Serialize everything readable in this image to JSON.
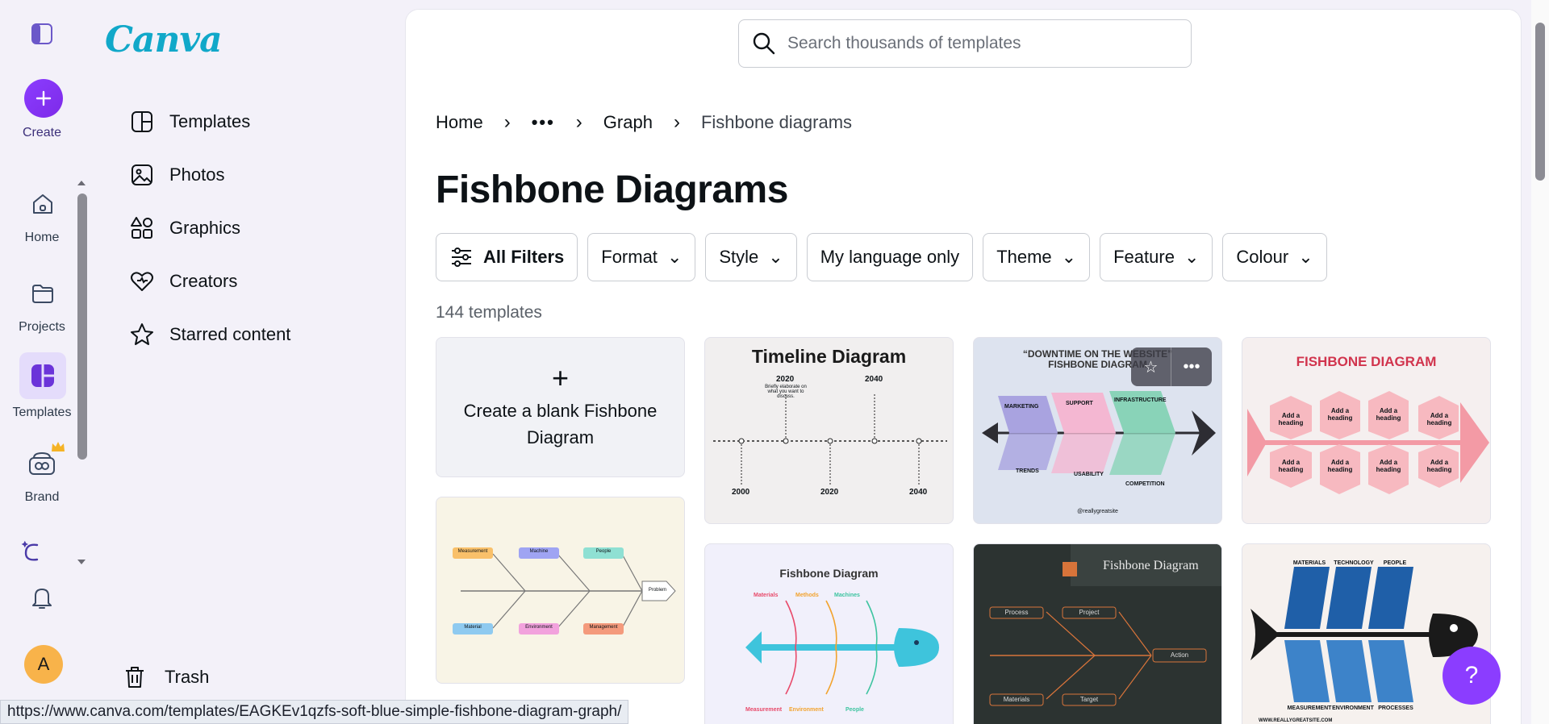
{
  "app": {
    "logo": "Canva"
  },
  "rail": {
    "create": "Create",
    "items": [
      {
        "label": "Home"
      },
      {
        "label": "Projects"
      },
      {
        "label": "Templates"
      },
      {
        "label": "Brand"
      }
    ],
    "avatar_initial": "A"
  },
  "side_nav": {
    "items": [
      {
        "label": "Templates"
      },
      {
        "label": "Photos"
      },
      {
        "label": "Graphics"
      },
      {
        "label": "Creators"
      },
      {
        "label": "Starred content"
      }
    ],
    "trash": "Trash"
  },
  "search": {
    "placeholder": "Search thousands of templates"
  },
  "breadcrumb": [
    "Home",
    "•••",
    "Graph",
    "Fishbone diagrams"
  ],
  "page_title": "Fishbone Diagrams",
  "filters": [
    "All Filters",
    "Format",
    "Style",
    "My language only",
    "Theme",
    "Feature",
    "Colour"
  ],
  "template_count": "144 templates",
  "blank_card": {
    "plus": "+",
    "text": "Create a blank Fishbone Diagram"
  },
  "cards": {
    "timeline": {
      "title": "Timeline Diagram",
      "years_top": [
        "2020",
        "2040"
      ],
      "years_bottom": [
        "2000",
        "2020",
        "2040"
      ],
      "caption": "Briefly elaborate on what you want to discuss."
    },
    "downtime": {
      "title": "“DOWNTIME ON THE WEBSITE” FISHBONE DIAGRAM",
      "labels": [
        "MARKETING",
        "SUPPORT",
        "INFRASTRUCTURE",
        "TRENDS",
        "USABILITY",
        "COMPETITION"
      ],
      "footer": "@reallygreatsite"
    },
    "pink": {
      "title": "FISHBONE DIAGRAM",
      "cell": "Add a heading"
    },
    "cream": {
      "boxes": [
        "Measurement",
        "Machine",
        "People",
        "Material",
        "Environment",
        "Management",
        "Problem"
      ]
    },
    "blue_fish": {
      "title": "Fishbone Diagram",
      "top": [
        "Materials",
        "Methods",
        "Machines"
      ],
      "bottom": [
        "Measurement",
        "Environment",
        "People"
      ]
    },
    "dark": {
      "title": "Fishbone Diagram",
      "boxes": [
        "Process",
        "Project",
        "Materials",
        "Target",
        "Action"
      ]
    },
    "materials": {
      "top": [
        "MATERIALS",
        "TECHNOLOGY",
        "PEOPLE"
      ],
      "bottom": [
        "MEASUREMENT",
        "ENVIRONMENT",
        "PROCESSES"
      ],
      "footer": "WWW.REALLYGREATSITE.COM"
    }
  },
  "help": "?",
  "status_url": "https://www.canva.com/templates/EAGKEv1qzfs-soft-blue-simple-fishbone-diagram-graph/",
  "colors": {
    "accent": "#8b3dff",
    "logo": "#11a8c9"
  }
}
